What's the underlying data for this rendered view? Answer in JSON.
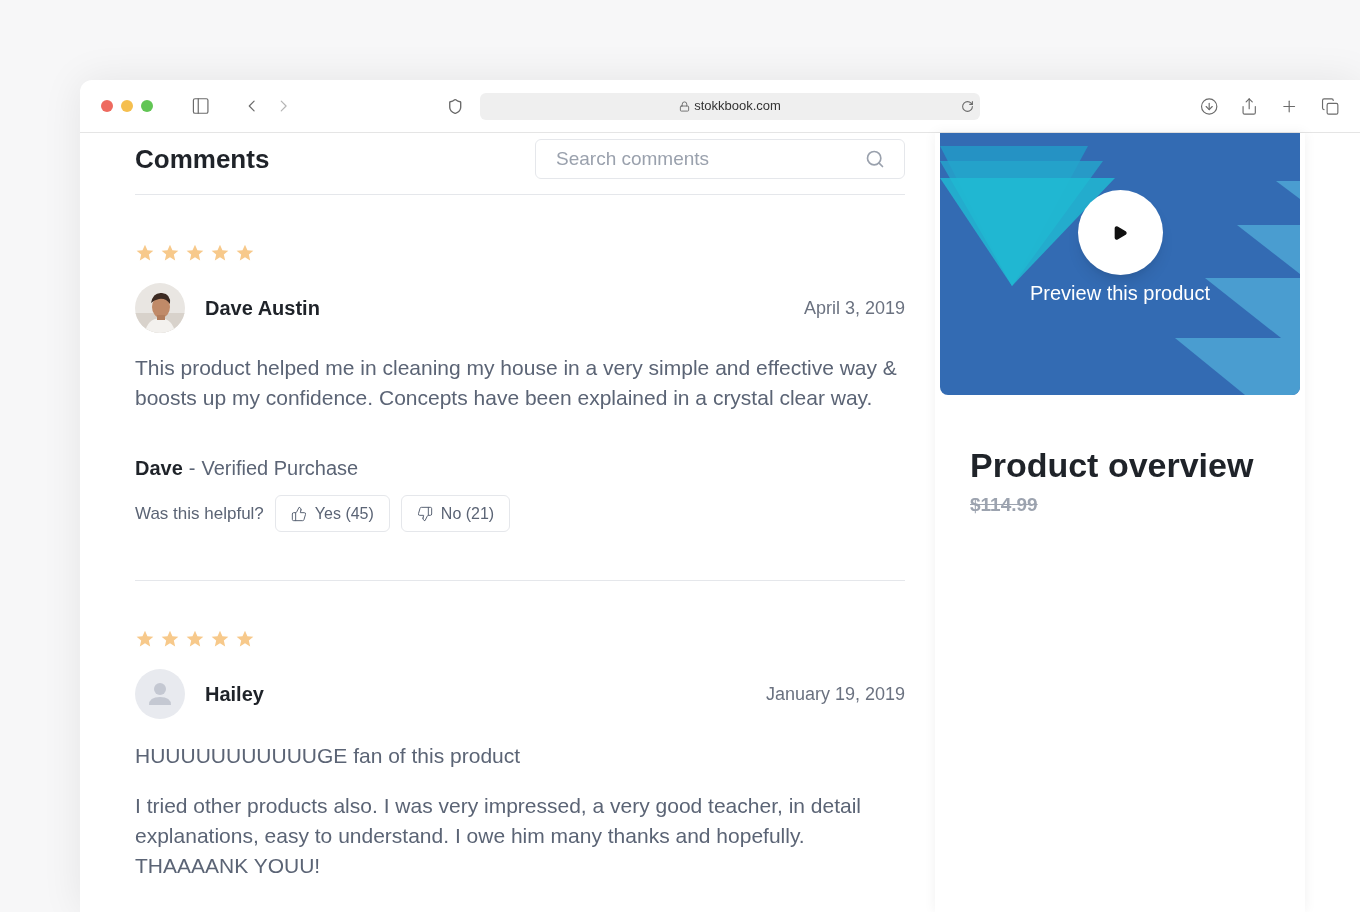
{
  "browser": {
    "url": "stokkbook.com"
  },
  "comments": {
    "title": "Comments",
    "search": {
      "placeholder": "Search comments"
    }
  },
  "reviews": [
    {
      "stars": 5,
      "author": "Dave Austin",
      "date": "April 3, 2019",
      "body": "This product helped me in cleaning my house in a very simple and effective way & boosts up my confidence. Concepts have been explained in a crystal clear way.",
      "signature": {
        "name": "Dave",
        "separator": "-",
        "note": "Verified Purchase"
      },
      "helpful": {
        "question": "Was this helpful?",
        "yes": "Yes (45)",
        "no": "No (21)"
      }
    },
    {
      "stars": 5,
      "avatar": {
        "kind": "placeholder"
      },
      "author": "Hailey",
      "date": "January 19, 2019",
      "title": "HUUUUUUUUUUUGE fan of this product",
      "body": "I tried other products also. I was very impressed, a very good teacher, in detail explanations, easy to understand. I owe him many thanks and hopefully. THAAAANK YOUU!"
    }
  ],
  "sidebar": {
    "preview": {
      "label": "Preview this product"
    },
    "heading": "Product overview",
    "old_price": "$114.99"
  }
}
